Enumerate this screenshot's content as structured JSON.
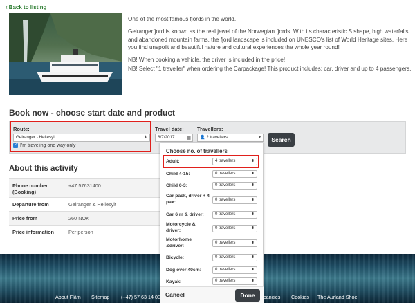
{
  "back_link": "Back to listing",
  "intro": {
    "p1": "One of the most famous fjords in the world.",
    "p2": "Geirangerfjord is known as the real jewel of the Norwegian fjords. With its characteristic S shape, high waterfalls and abandoned mountain farms, the fjord landscape is included on UNESCO's list of World Heritage sites. Here you find unspoilt and beautiful nature and cultural experiences the whole year round!",
    "p3a": "NB! When booking a vehicle, the driver is included in the price!",
    "p3b": "NB! Select \"1 traveller\" when ordering the Carpackage! This product includes: car, driver and up to 4 passengers."
  },
  "booking": {
    "title": "Book now - choose start date and product",
    "route_label": "Route:",
    "route_value": "Geiranger - Hellesylt",
    "oneway_label": "I'm traveling one way only",
    "date_label": "Travel date:",
    "date_value": "8/7/2017",
    "travellers_label": "Travellers:",
    "travellers_value": "2 travellers",
    "search_label": "Search"
  },
  "about": {
    "title": "About this activity",
    "rows": [
      {
        "key": "Phone number (Booking)",
        "value": "+47 57631400"
      },
      {
        "key": "Departure from",
        "value": "Geiranger & Hellesylt"
      },
      {
        "key": "Price from",
        "value": "260 NOK"
      },
      {
        "key": "Price information",
        "value": "Per person"
      }
    ]
  },
  "popup": {
    "title": "Choose no. of travellers",
    "rows": [
      {
        "label": "Adult:",
        "value": "4 travellers"
      },
      {
        "label": "Child 4-15:",
        "value": "0 travellers"
      },
      {
        "label": "Child 0-3:",
        "value": "0 travellers"
      },
      {
        "label": "Car pack, driver + 4 pax:",
        "value": "0 travellers"
      },
      {
        "label": "Car 6 m & driver:",
        "value": "0 travellers"
      },
      {
        "label": "Motorcycle & driver:",
        "value": "0 travellers"
      },
      {
        "label": "Motorhome &driver:",
        "value": "0 travellers"
      },
      {
        "label": "Bicycle:",
        "value": "0 travellers"
      },
      {
        "label": "Dog over 40cm:",
        "value": "0 travellers"
      },
      {
        "label": "Kayak:",
        "value": "0 travellers"
      }
    ],
    "cancel_label": "Cancel",
    "done_label": "Done"
  },
  "footer": {
    "links": [
      "About Flåm",
      "Sitemap",
      "(+47) 57 63 14 00",
      "cancies",
      "Cookies",
      "The Aurland Shoe"
    ]
  },
  "colors": {
    "link_green": "#2e7d32",
    "highlight_red": "#e0201c",
    "button_dark": "#3a3f44",
    "panel_gray": "#e8e9ea",
    "checkbox_blue": "#2a7fd4"
  }
}
